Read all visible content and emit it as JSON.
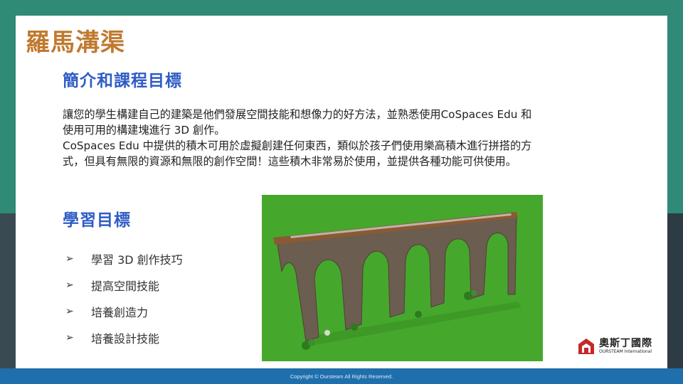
{
  "slide": {
    "title": "羅馬溝渠",
    "intro_heading": "簡介和課程目標",
    "intro_lines": [
      "讓您的學生構建自己的建築是他們發展空間技能和想像力的好方法，並熟悉使用CoSpaces Edu 和",
      "使用可用的構建塊進行 3D 創作。",
      "CoSpaces Edu 中提供的積木可用於虛擬創建任何東西，類似於孩子們使用樂高積木進行拼搭的方",
      "式，但具有無限的資源和無限的創作空間！這些積木非常易於使用，並提供各種功能可供使用。"
    ],
    "goals_heading": "學習目標",
    "goals": [
      "學習 3D 創作技巧",
      "提高空間技能",
      "培養創造力",
      "培養設計技能"
    ],
    "bullet_icon": "arrowhead-bullet-icon"
  },
  "image": {
    "alt_subject": "roman-aqueduct-3d-model"
  },
  "logo": {
    "name_cn": "奧斯丁國際",
    "name_en": "OURSTEAM International"
  },
  "footer": {
    "copyright": "Copyright © Oursteam All Rights Reserved."
  },
  "colors": {
    "title": "#c07a2f",
    "heading": "#2f5cc6",
    "footer_bar": "#1f6fad",
    "frame_green": "#2f8a76",
    "scene_green": "#45a82c"
  }
}
